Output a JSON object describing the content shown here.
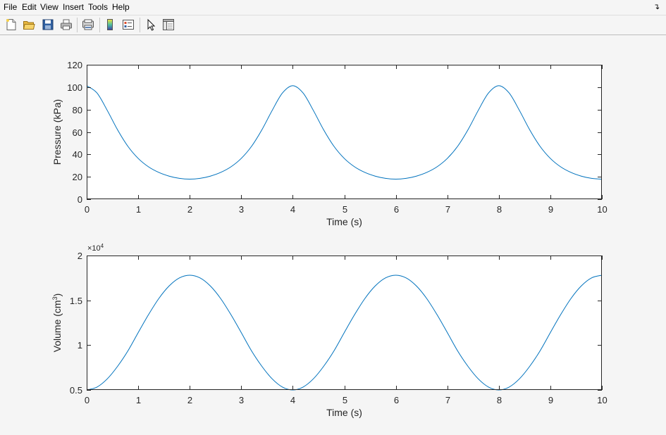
{
  "menu": {
    "items": [
      "File",
      "Edit",
      "View",
      "Insert",
      "Tools",
      "Help"
    ],
    "dock_icon": "undock-arrow-icon"
  },
  "toolbar": {
    "buttons": [
      "new-figure-icon",
      "open-file-icon",
      "save-figure-icon",
      "print-figure-icon",
      "link-plot-icon",
      "insert-colorbar-icon",
      "insert-legend-icon",
      "edit-plot-arrow-icon",
      "property-inspector-icon"
    ]
  },
  "colors": {
    "line": "#0072bd",
    "axes_bg": "#ffffff",
    "figure_bg": "#f5f5f5"
  },
  "chart_data": [
    {
      "type": "line",
      "title": "",
      "xlabel": "Time (s)",
      "ylabel": "Pressure (kPa)",
      "xlim": [
        0,
        10
      ],
      "ylim": [
        0,
        120
      ],
      "xticks": [
        0,
        1,
        2,
        3,
        4,
        5,
        6,
        7,
        8,
        9,
        10
      ],
      "yticks": [
        0,
        20,
        40,
        60,
        80,
        100,
        120
      ],
      "grid": false,
      "series": [
        {
          "x": [
            0,
            0.2,
            0.4,
            0.6,
            0.8,
            1.0,
            1.2,
            1.4,
            1.6,
            1.8,
            2.0,
            2.2,
            2.4,
            2.6,
            2.8,
            3.0,
            3.2,
            3.4,
            3.6,
            3.8,
            4.0,
            4.2,
            4.4,
            4.6,
            4.8,
            5.0,
            5.2,
            5.4,
            5.6,
            5.8,
            6.0,
            6.2,
            6.4,
            6.6,
            6.8,
            7.0,
            7.2,
            7.4,
            7.6,
            7.8,
            8.0,
            8.2,
            8.4,
            8.6,
            8.8,
            9.0,
            9.2,
            9.4,
            9.6,
            9.8,
            10.0
          ],
          "y": [
            101.3,
            94.8,
            79.2,
            61.9,
            47.2,
            36.4,
            28.9,
            23.9,
            20.6,
            18.6,
            17.9,
            18.6,
            20.6,
            23.9,
            28.9,
            36.4,
            47.2,
            61.9,
            79.2,
            94.8,
            101.3,
            94.8,
            79.2,
            61.9,
            47.2,
            36.4,
            28.9,
            23.9,
            20.6,
            18.6,
            17.9,
            18.6,
            20.6,
            23.9,
            28.9,
            36.4,
            47.2,
            61.9,
            79.2,
            94.8,
            101.3,
            94.8,
            79.2,
            61.9,
            47.2,
            36.4,
            28.9,
            23.9,
            20.6,
            18.6,
            17.9
          ]
        }
      ]
    },
    {
      "type": "line",
      "title": "",
      "xlabel": "Time (s)",
      "ylabel": "Volume  (cm",
      "ylabel_sup": "3",
      "ylabel_end": ")",
      "exponent_base": "×10",
      "exponent_power": "4",
      "xlim": [
        0,
        10
      ],
      "ylim": [
        0.5,
        2
      ],
      "xticks": [
        0,
        1,
        2,
        3,
        4,
        5,
        6,
        7,
        8,
        9,
        10
      ],
      "yticks": [
        0.5,
        1,
        1.5,
        2
      ],
      "ytick_labels": [
        "0.5",
        "1",
        "1.5",
        "2"
      ],
      "grid": false,
      "series": [
        {
          "x": [
            0,
            0.2,
            0.4,
            0.6,
            0.8,
            1.0,
            1.2,
            1.4,
            1.6,
            1.8,
            2.0,
            2.2,
            2.4,
            2.6,
            2.8,
            3.0,
            3.2,
            3.4,
            3.6,
            3.8,
            4.0,
            4.2,
            4.4,
            4.6,
            4.8,
            5.0,
            5.2,
            5.4,
            5.6,
            5.8,
            6.0,
            6.2,
            6.4,
            6.6,
            6.8,
            7.0,
            7.2,
            7.4,
            7.6,
            7.8,
            8.0,
            8.2,
            8.4,
            8.6,
            8.8,
            9.0,
            9.2,
            9.4,
            9.6,
            9.8,
            10.0
          ],
          "y": [
            0.5,
            0.532,
            0.624,
            0.764,
            0.936,
            1.14,
            1.34,
            1.52,
            1.66,
            1.75,
            1.78,
            1.75,
            1.66,
            1.52,
            1.34,
            1.14,
            0.936,
            0.764,
            0.624,
            0.532,
            0.5,
            0.532,
            0.624,
            0.764,
            0.936,
            1.14,
            1.34,
            1.52,
            1.66,
            1.75,
            1.78,
            1.75,
            1.66,
            1.52,
            1.34,
            1.14,
            0.936,
            0.764,
            0.624,
            0.532,
            0.5,
            0.532,
            0.624,
            0.764,
            0.936,
            1.14,
            1.34,
            1.52,
            1.66,
            1.75,
            1.78
          ]
        }
      ]
    }
  ]
}
